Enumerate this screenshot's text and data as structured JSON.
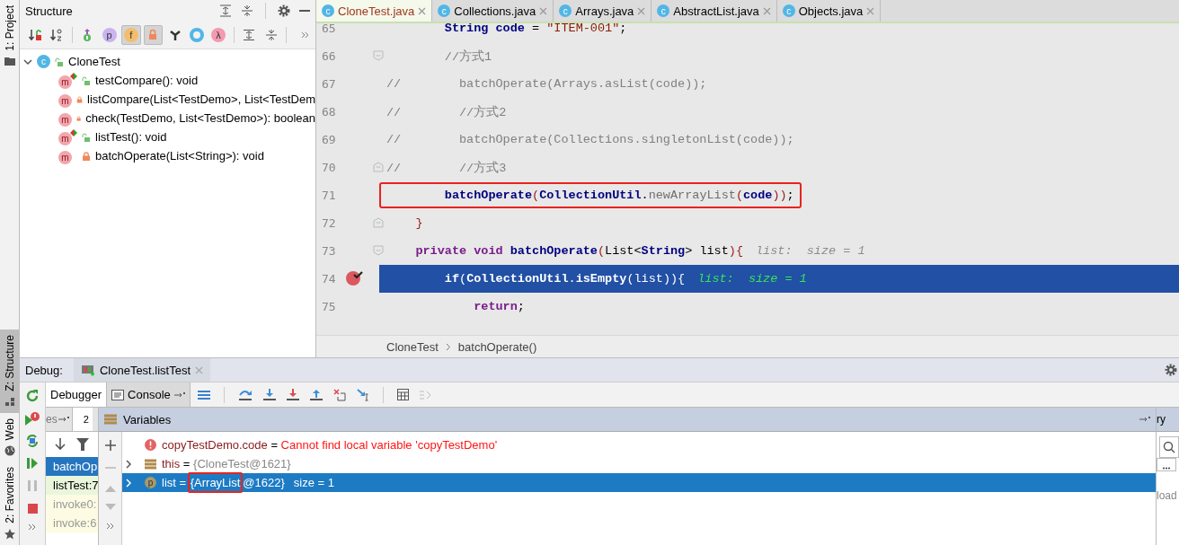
{
  "left_stripe": {
    "top_tabs": [
      {
        "label": "1: Project",
        "selected": false
      }
    ],
    "bottom_tabs": [
      {
        "label": "Z: Structure",
        "selected": true
      },
      {
        "label": "Web",
        "selected": false
      },
      {
        "label": "2: Favorites",
        "selected": false
      }
    ]
  },
  "structure": {
    "title": "Structure",
    "toolbar": [
      {
        "kind": "sort-visibility",
        "pressed": false
      },
      {
        "kind": "sort-alpha",
        "pressed": false
      },
      {
        "kind": "inherited",
        "pressed": false
      },
      {
        "kind": "properties",
        "glyph": "p",
        "pressed": false
      },
      {
        "kind": "fields",
        "glyph": "f",
        "pressed": true
      },
      {
        "kind": "non-public",
        "pressed": true
      },
      {
        "kind": "anonymous",
        "pressed": false
      },
      {
        "kind": "ring",
        "pressed": false
      },
      {
        "kind": "lambdas",
        "glyph": "λ",
        "pressed": false
      },
      {
        "kind": "expand",
        "pressed": false
      },
      {
        "kind": "collapse",
        "pressed": false
      }
    ],
    "tree": {
      "label": "CloneTest",
      "glyph": "c",
      "expanded": true,
      "children": [
        {
          "label": "testCompare(): void",
          "glyph": "m",
          "private": false,
          "runnable": true
        },
        {
          "label": "listCompare(List<TestDemo>, List<TestDem",
          "glyph": "m",
          "private": true,
          "runnable": false
        },
        {
          "label": "check(TestDemo, List<TestDemo>): boolean",
          "glyph": "m",
          "private": true,
          "runnable": false
        },
        {
          "label": "listTest(): void",
          "glyph": "m",
          "private": false,
          "runnable": true
        },
        {
          "label": "batchOperate(List<String>): void",
          "glyph": "m",
          "private": true,
          "runnable": false
        }
      ]
    }
  },
  "editor": {
    "tabs": [
      {
        "label": "CloneTest.java",
        "glyph": "c",
        "selected": true
      },
      {
        "label": "Collections.java",
        "glyph": "c",
        "selected": false
      },
      {
        "label": "Arrays.java",
        "glyph": "c",
        "selected": false
      },
      {
        "label": "AbstractList.java",
        "glyph": "c",
        "selected": false
      },
      {
        "label": "Objects.java",
        "glyph": "c",
        "selected": false
      }
    ],
    "lines": [
      {
        "number": "65",
        "selected": false,
        "boxed": false,
        "tokens": [
          {
            "kind": "ident",
            "text": "        String"
          },
          {
            "kind": "ident",
            "text": " code"
          },
          {
            "kind": "plain",
            "text": " = "
          },
          {
            "kind": "string",
            "text": "\"ITEM-001\""
          },
          {
            "kind": "plain",
            "text": ";"
          }
        ]
      },
      {
        "number": "66",
        "selected": false,
        "boxed": false,
        "fold_start": true,
        "tokens": [
          {
            "kind": "comment",
            "text": "        //方式1"
          }
        ]
      },
      {
        "number": "67",
        "selected": false,
        "boxed": false,
        "tokens": [
          {
            "kind": "comment",
            "text": "//        batchOperate(Arrays.asList(code));"
          }
        ]
      },
      {
        "number": "68",
        "selected": false,
        "boxed": false,
        "tokens": [
          {
            "kind": "comment",
            "text": "//        //方式2"
          }
        ]
      },
      {
        "number": "69",
        "selected": false,
        "boxed": false,
        "tokens": [
          {
            "kind": "comment",
            "text": "//        batchOperate(Collections.singletonList(code));"
          }
        ]
      },
      {
        "number": "70",
        "selected": false,
        "boxed": false,
        "fold_end": true,
        "tokens": [
          {
            "kind": "comment",
            "text": "//        //方式3"
          }
        ]
      },
      {
        "number": "71",
        "selected": false,
        "boxed": true,
        "tokens": [
          {
            "kind": "ident",
            "text": "        batchOperate"
          },
          {
            "kind": "paren",
            "text": "("
          },
          {
            "kind": "ident",
            "text": "CollectionUtil"
          },
          {
            "kind": "plain",
            "text": "."
          },
          {
            "kind": "static",
            "text": "newArrayList"
          },
          {
            "kind": "paren",
            "text": "("
          },
          {
            "kind": "ident",
            "text": "code"
          },
          {
            "kind": "paren",
            "text": "))"
          },
          {
            "kind": "plain",
            "text": ";"
          }
        ]
      },
      {
        "number": "72",
        "selected": false,
        "boxed": false,
        "fold_end": true,
        "tokens": [
          {
            "kind": "paren",
            "text": "    }"
          }
        ]
      },
      {
        "number": "73",
        "selected": false,
        "boxed": false,
        "fold_start": true,
        "hint": "list:  size = 1",
        "tokens": [
          {
            "kind": "keyword",
            "text": "    private void"
          },
          {
            "kind": "ident",
            "text": " batchOperate"
          },
          {
            "kind": "paren",
            "text": "("
          },
          {
            "kind": "plain",
            "text": "List<"
          },
          {
            "kind": "ident",
            "text": "String"
          },
          {
            "kind": "plain",
            "text": "> list"
          },
          {
            "kind": "paren",
            "text": "){"
          }
        ]
      },
      {
        "number": "74",
        "selected": true,
        "boxed": false,
        "breakpoint": true,
        "hint": "list:  size = 1",
        "tokens": [
          {
            "kind": "keyword",
            "text": "        if"
          },
          {
            "kind": "paren",
            "text": "("
          },
          {
            "kind": "ident",
            "text": "CollectionUtil"
          },
          {
            "kind": "plain",
            "text": "."
          },
          {
            "kind": "ident",
            "text": "isEmpty"
          },
          {
            "kind": "paren",
            "text": "("
          },
          {
            "kind": "plain",
            "text": "list"
          },
          {
            "kind": "paren",
            "text": ")){"
          }
        ]
      },
      {
        "number": "75",
        "selected": false,
        "boxed": false,
        "tokens": [
          {
            "kind": "keyword",
            "text": "            return"
          },
          {
            "kind": "plain",
            "text": ";"
          }
        ]
      }
    ],
    "breadcrumbs": [
      "CloneTest",
      "batchOperate()"
    ]
  },
  "debug": {
    "title": "Debug:",
    "session": "CloneTest.listTest",
    "tabs": [
      {
        "label": "Debugger",
        "selected": true
      },
      {
        "label": "Console",
        "selected": false
      }
    ],
    "frames": {
      "tab_fragment": "es",
      "threads_count": "2",
      "rows": [
        {
          "label": "batchOp",
          "kind": "current",
          "selected": true
        },
        {
          "label": "listTest:7",
          "kind": "user",
          "selected": false
        },
        {
          "label": "invoke0:",
          "kind": "library",
          "selected": false
        },
        {
          "label": "invoke:6",
          "kind": "library",
          "selected": false
        }
      ]
    },
    "variables": {
      "title": "Variables",
      "rows": [
        {
          "kind": "error",
          "name": "copyTestDemo.code",
          "operator": "=",
          "value": [
            {
              "text": "Cannot find local variable 'copyTestDemo'",
              "boxed": false
            }
          ],
          "expandable": false,
          "selected": false
        },
        {
          "kind": "object",
          "name": "this",
          "operator": "=",
          "value": [
            {
              "text": "{CloneTest@1621}",
              "boxed": false
            }
          ],
          "expandable": true,
          "selected": false
        },
        {
          "kind": "param",
          "glyph": "p",
          "name": "list",
          "operator": "=",
          "value": [
            {
              "text": "{ArrayList",
              "boxed": true
            },
            {
              "text": "@1622}",
              "boxed": false
            }
          ],
          "extra": "size = 1",
          "expandable": true,
          "selected": true
        }
      ]
    },
    "memory": {
      "tab_fragment": "ry",
      "text": "load"
    }
  }
}
